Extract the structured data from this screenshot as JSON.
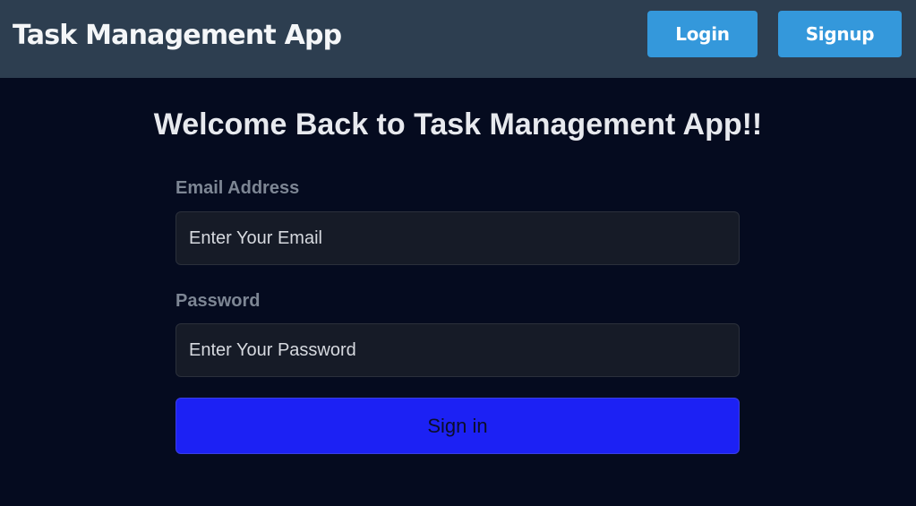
{
  "navbar": {
    "brand": "Task Management App",
    "login_label": "Login",
    "signup_label": "Signup",
    "accent_color": "#3498db",
    "background_color": "#2d3e50"
  },
  "main": {
    "heading": "Welcome Back to Task Management App!!",
    "email": {
      "label": "Email Address",
      "placeholder": "Enter Your Email",
      "value": ""
    },
    "password": {
      "label": "Password",
      "placeholder": "Enter Your Password",
      "value": ""
    },
    "signin_label": "Sign in",
    "signin_color": "#1c21f4"
  }
}
